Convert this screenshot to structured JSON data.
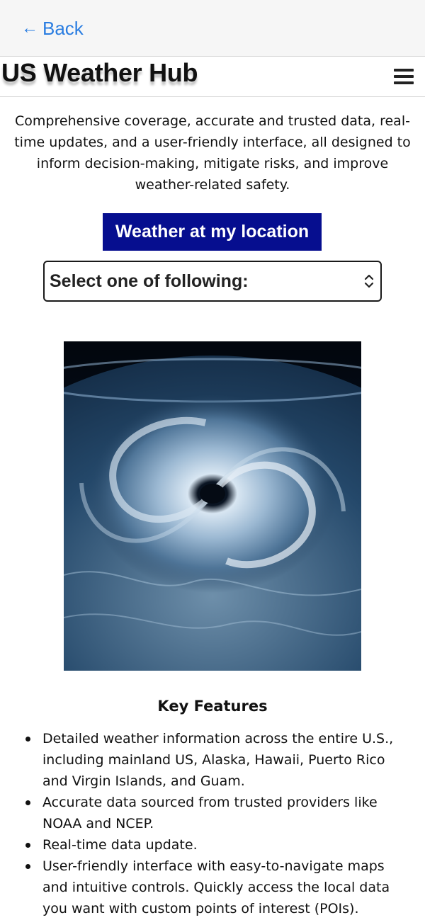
{
  "nav": {
    "back_label": "Back",
    "back_icon": "arrow-left-icon"
  },
  "header": {
    "brand": "US Weather Hub",
    "menu_icon": "hamburger-menu-icon"
  },
  "intro": {
    "text": "Comprehensive coverage, accurate and trusted data, real-time updates, and a user-friendly interface, all designed to inform decision-making, mitigate risks, and improve weather-related safety."
  },
  "cta": {
    "label": "Weather at my location",
    "background": "#060e8f"
  },
  "selector": {
    "value": "Select one of following:",
    "icon": "updown-chevron-icon"
  },
  "hero": {
    "image": "hurricane-from-space"
  },
  "features": {
    "title": "Key Features",
    "items": [
      "Detailed weather information across the entire U.S., including mainland US, Alaska, Hawaii, Puerto Rico and Virgin Islands, and Guam.",
      "Accurate data sourced from trusted providers like NOAA and NCEP.",
      "Real-time data update.",
      "User-friendly interface with easy-to-navigate maps and intuitive controls. Quickly access the local data you want with custom points of interest (POIs)."
    ]
  },
  "colors": {
    "link": "#2a7de1",
    "topbar": "#f6f6f6"
  }
}
